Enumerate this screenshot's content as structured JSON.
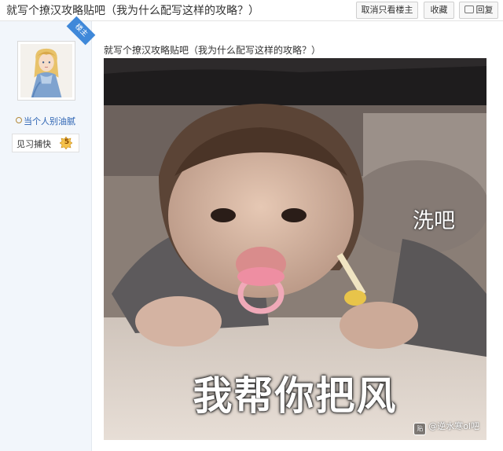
{
  "header": {
    "title": "就写个撩汉攻略贴吧（我为什么配写这样的攻略？）",
    "buttons": {
      "only_op": "取消只看楼主",
      "favorite": "收藏",
      "reply": "回复"
    }
  },
  "author": {
    "badge": "楼主",
    "name": "当个人别油腻",
    "level_name": "见习捕快",
    "level": "5"
  },
  "post": {
    "title": "就写个撩汉攻略贴吧（我为什么配写这样的攻略？）",
    "meme": {
      "side_text": "洗吧",
      "caption": "我帮你把风",
      "watermark": "@逆水寒ol吧",
      "watermark_logo": "贴"
    }
  },
  "colors": {
    "link_blue": "#2d64b3",
    "sidebar_bg": "#f2f6fb",
    "op_badge": "#3f88d9"
  }
}
